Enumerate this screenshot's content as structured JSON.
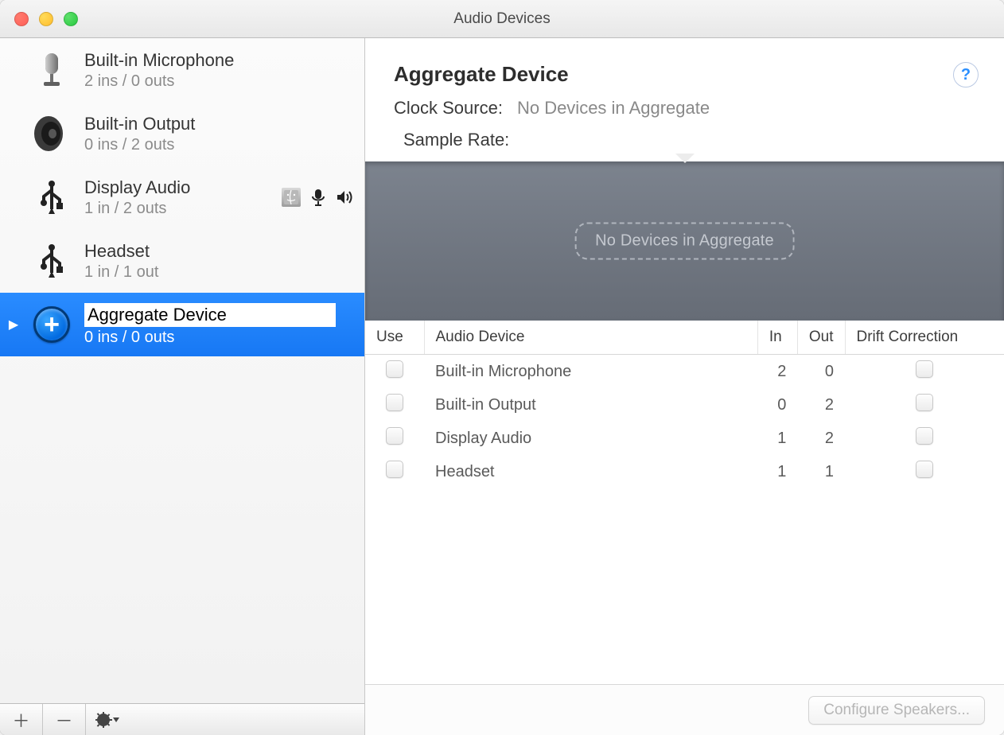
{
  "window": {
    "title": "Audio Devices"
  },
  "sidebar": {
    "devices": [
      {
        "name": "Built-in Microphone",
        "sub": "2 ins / 0 outs",
        "icon": "mic"
      },
      {
        "name": "Built-in Output",
        "sub": "0 ins / 2 outs",
        "icon": "speaker"
      },
      {
        "name": "Display Audio",
        "sub": "1 in / 2 outs",
        "icon": "usb",
        "indicators": true
      },
      {
        "name": "Headset",
        "sub": "1 in / 1 out",
        "icon": "usb"
      },
      {
        "name": "Aggregate Device",
        "sub": "0 ins / 0 outs",
        "icon": "plus",
        "selected": true,
        "editing": true
      }
    ]
  },
  "detail": {
    "title": "Aggregate Device",
    "clock_label": "Clock Source:",
    "clock_value": "No Devices in Aggregate",
    "sample_label": "Sample Rate:",
    "placeholder": "No Devices in Aggregate"
  },
  "table": {
    "headers": {
      "use": "Use",
      "device": "Audio Device",
      "in": "In",
      "out": "Out",
      "drift": "Drift Correction"
    },
    "rows": [
      {
        "device": "Built-in Microphone",
        "in": "2",
        "out": "0"
      },
      {
        "device": "Built-in Output",
        "in": "0",
        "out": "2"
      },
      {
        "device": "Display Audio",
        "in": "1",
        "out": "2"
      },
      {
        "device": "Headset",
        "in": "1",
        "out": "1"
      }
    ]
  },
  "footer_button": "Configure Speakers..."
}
